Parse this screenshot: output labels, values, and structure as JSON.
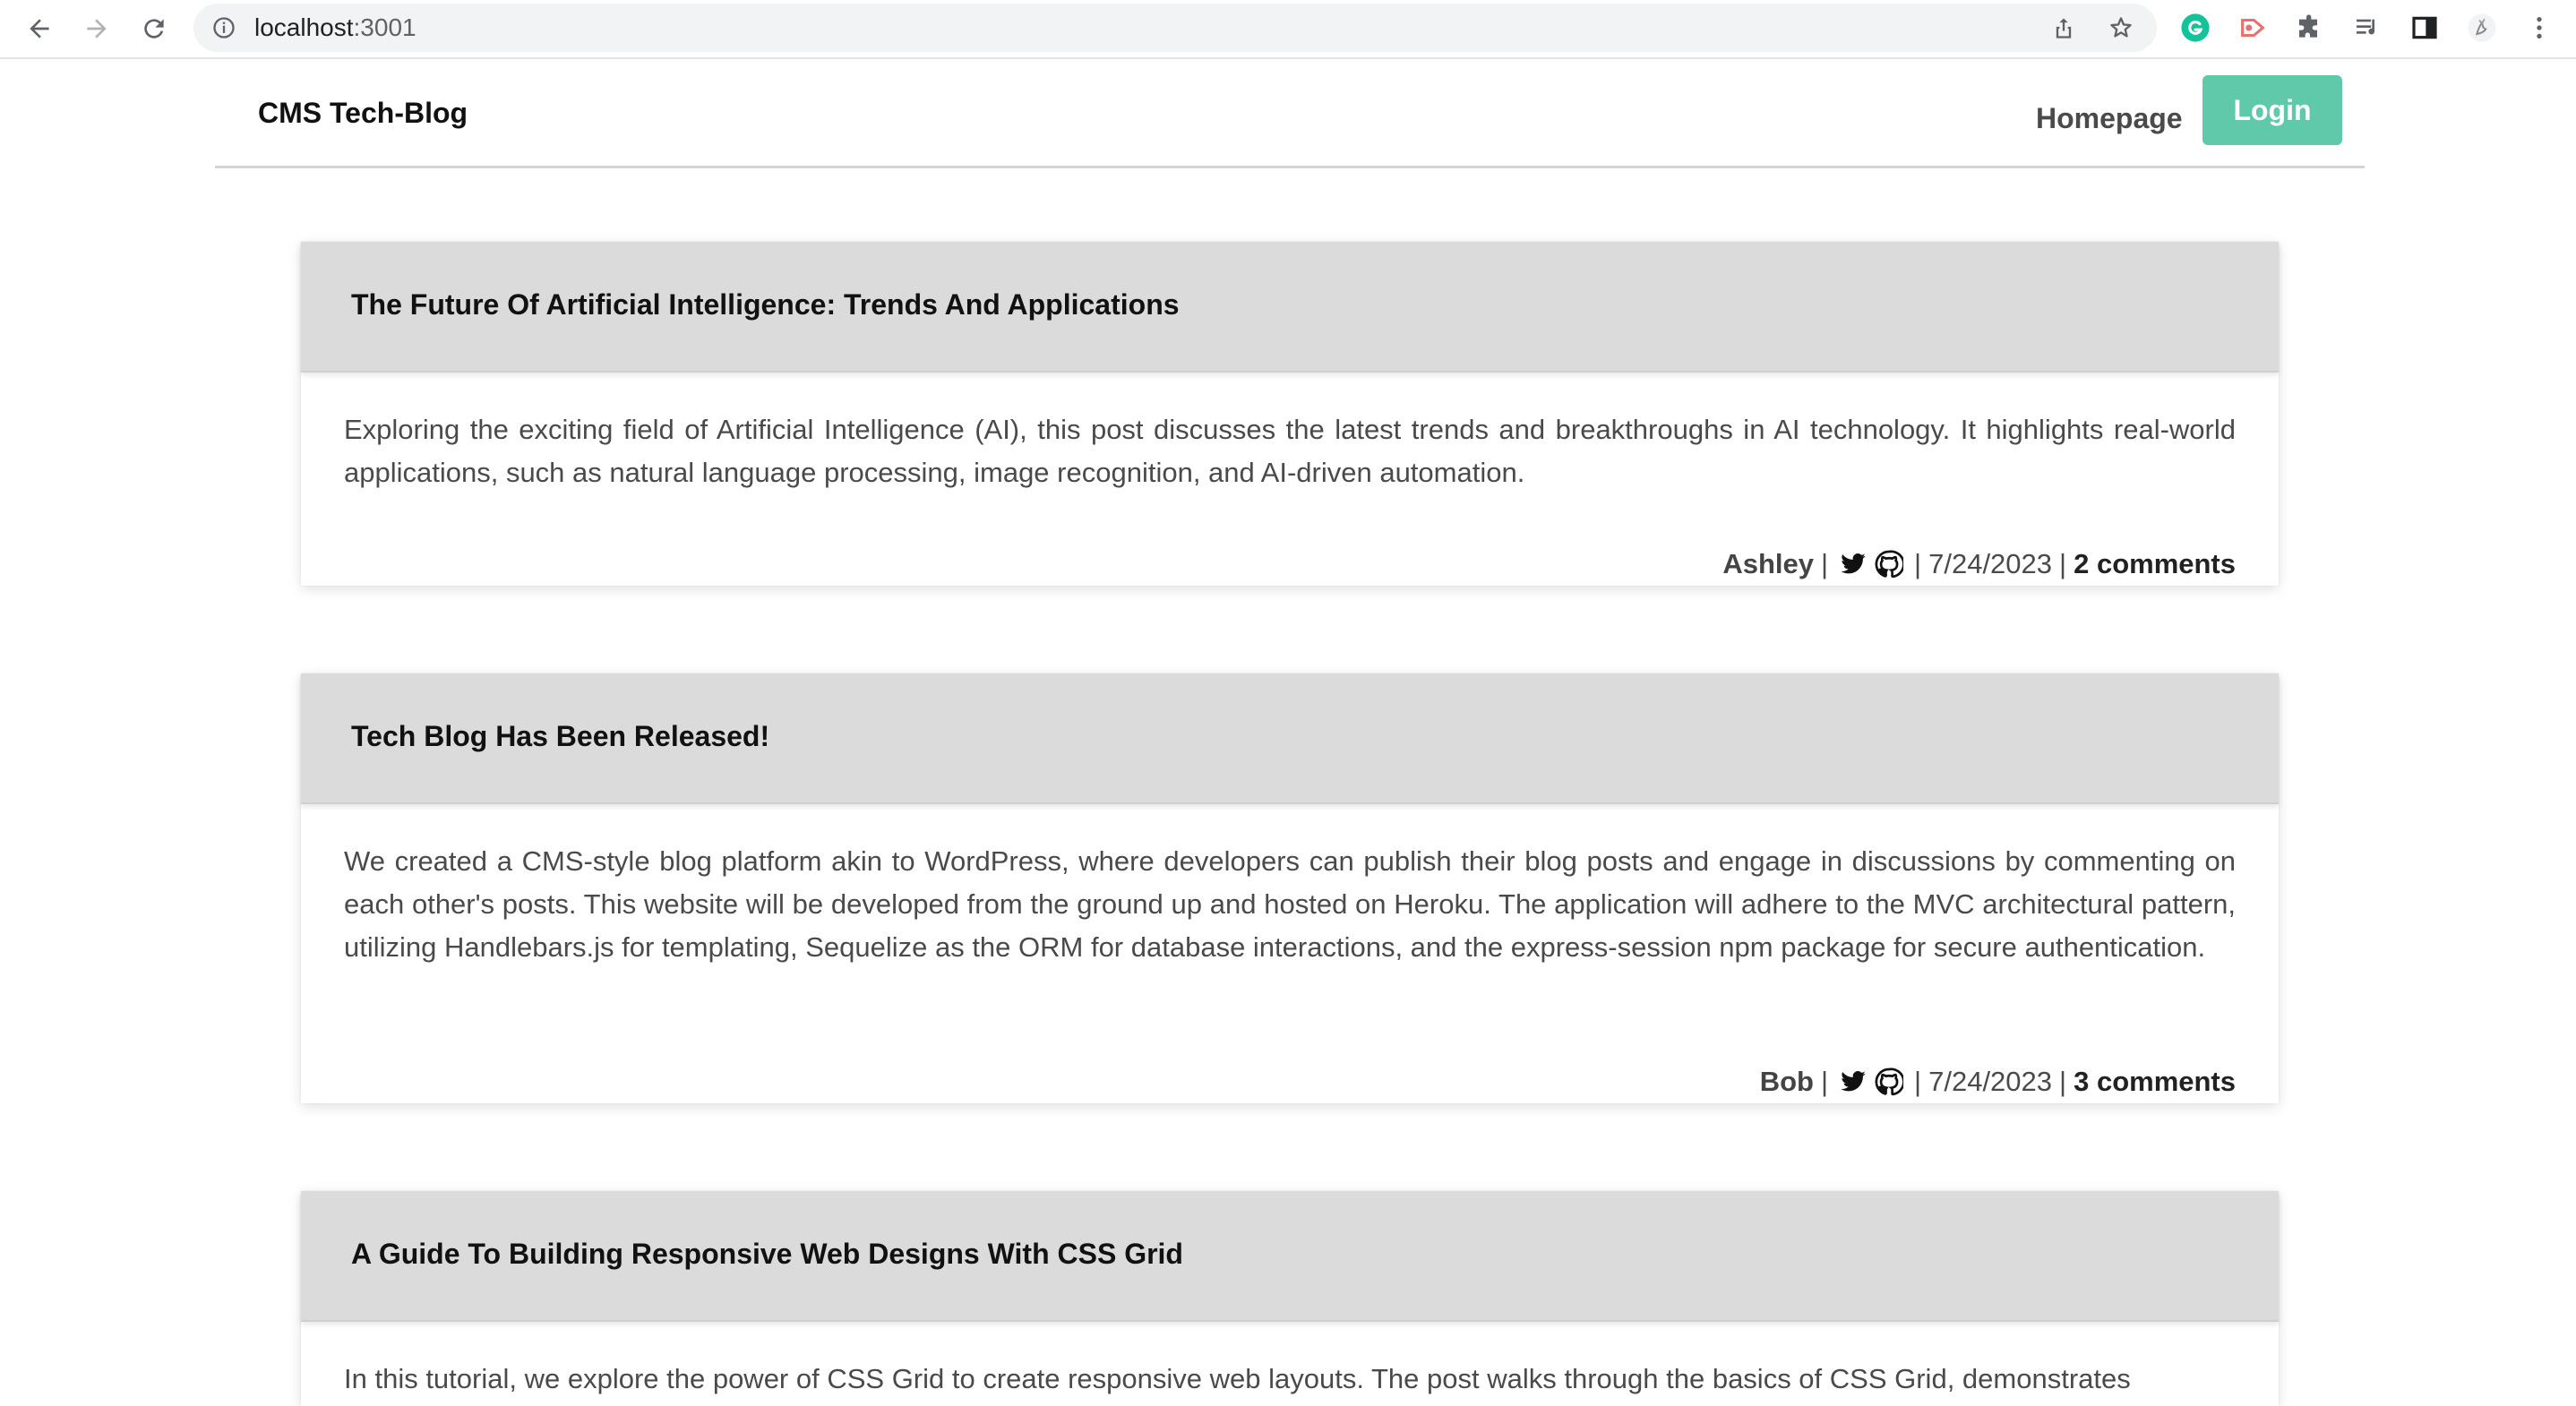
{
  "browser": {
    "url_host": "localhost",
    "url_port": ":3001"
  },
  "site": {
    "brand": "CMS Tech-Blog",
    "nav": {
      "homepage": "Homepage",
      "login": "Login"
    }
  },
  "posts": [
    {
      "title": "The Future Of Artificial Intelligence: Trends And Applications",
      "body": "Exploring the exciting field of Artificial Intelligence (AI), this post discusses the latest trends and breakthroughs in AI technology. It highlights real-world applications, such as natural language processing, image recognition, and AI-driven automation.",
      "author": "Ashley",
      "date": "7/24/2023",
      "comments": "2 comments"
    },
    {
      "title": "Tech Blog Has Been Released!",
      "body": "We created a CMS-style blog platform akin to WordPress, where developers can publish their blog posts and engage in discussions by commenting on each other's posts. This website will be developed from the ground up and hosted on Heroku. The application will adhere to the MVC architectural pattern, utilizing Handlebars.js for templating, Sequelize as the ORM for database interactions, and the express-session npm package for secure authentication.",
      "author": "Bob",
      "date": "7/24/2023",
      "comments": "3 comments"
    },
    {
      "title": "A Guide To Building Responsive Web Designs With CSS Grid",
      "body": "In this tutorial, we explore the power of CSS Grid to create responsive web layouts. The post walks through the basics of CSS Grid, demonstrates"
    }
  ],
  "colors": {
    "accent": "#5fc9a9",
    "post_header_bg": "#dbdbdb"
  },
  "separator": "|"
}
